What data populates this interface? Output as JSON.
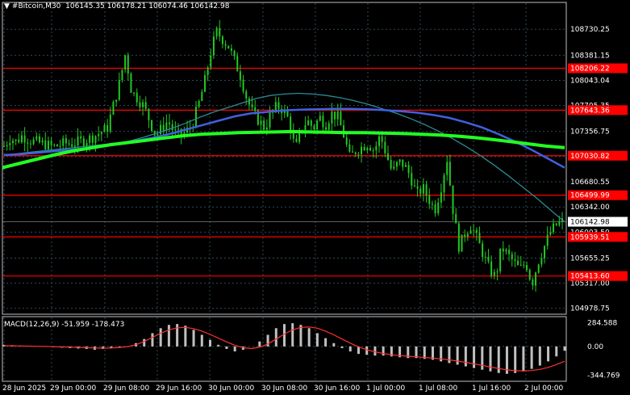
{
  "header": {
    "symbol": "#Bitcoin,M30",
    "open": "106145.35",
    "high": "106178.21",
    "low": "106074.46",
    "close": "106142.98"
  },
  "macd_header": {
    "label": "MACD(12,26,9)",
    "macd": "-51.959",
    "signal": "-178.473"
  },
  "colors": {
    "background": "#000000",
    "grid": "#2e4a5a",
    "candle": "#22c822",
    "ma_fast": "#2a8a94",
    "ma_mid": "#4060e0",
    "ma_slow": "#22ff22",
    "level": "#ff0000",
    "macd_hist": "#c0c0c0",
    "macd_signal": "#ff3030",
    "current_price_line": "#808080"
  },
  "chart_data": {
    "type": "candlestick",
    "y_axis_ticks": [
      108730.25,
      108381.15,
      108043.04,
      107705.35,
      107356.75,
      107018.65,
      106680.55,
      106342.0,
      106003.5,
      105655.25,
      105317.0,
      104978.75
    ],
    "ylim": [
      104900,
      108950
    ],
    "x_axis_ticks": [
      "28 Jun 2025",
      "29 Jun 00:00",
      "29 Jun 08:00",
      "29 Jun 16:00",
      "30 Jun 00:00",
      "30 Jun 08:00",
      "30 Jun 16:00",
      "1 Jul 00:00",
      "1 Jul 08:00",
      "1 Jul 16:00",
      "2 Jul 00:00"
    ],
    "current_price": "106142.98",
    "levels": [
      {
        "price": "108206.22",
        "value": 108206.22
      },
      {
        "price": "107643.36",
        "value": 107643.36
      },
      {
        "price": "107030.82",
        "value": 107030.82
      },
      {
        "price": "106499.99",
        "value": 106499.99
      },
      {
        "price": "105939.51",
        "value": 105939.51
      },
      {
        "price": "105413.60",
        "value": 105413.6
      }
    ],
    "close_path": [
      107160,
      107270,
      107220,
      107300,
      107250,
      107220,
      107200,
      107180,
      107150,
      107170,
      107200,
      107190,
      107210,
      107230,
      107260,
      107300,
      107350,
      107400,
      107700,
      108000,
      108400,
      107900,
      107800,
      107700,
      107500,
      107300,
      107400,
      107500,
      107350,
      107300,
      107350,
      107450,
      107700,
      108000,
      108400,
      108700,
      108600,
      108500,
      108300,
      108100,
      107800,
      107600,
      107500,
      107400,
      107600,
      107700,
      107650,
      107500,
      107100,
      107400,
      107500,
      107400,
      107550,
      107450,
      107600,
      107550,
      107300,
      107000,
      107100,
      107150,
      107200,
      107100,
      107300,
      107050,
      106800,
      106950,
      106900,
      106750,
      106500,
      106600,
      106450,
      106300,
      106600,
      107000,
      106300,
      105800,
      106000,
      106100,
      105900,
      105700,
      105500,
      105400,
      105800,
      105700,
      105600,
      105500,
      105600,
      105300,
      105600,
      105800,
      106000,
      106100,
      106143
    ],
    "ma_fast": [
      107040,
      107060,
      107080,
      107100,
      107120,
      107140,
      107160,
      107180,
      107200,
      107230,
      107280,
      107340,
      107400,
      107470,
      107550,
      107620,
      107680,
      107740,
      107800,
      107840,
      107860,
      107870,
      107860,
      107840,
      107810,
      107770,
      107720,
      107660,
      107600,
      107530,
      107450,
      107360,
      107260,
      107150,
      107030,
      106900,
      106760,
      106610,
      106460,
      106300,
      106140
    ],
    "ma_mid": [
      107040,
      107050,
      107070,
      107090,
      107110,
      107130,
      107160,
      107190,
      107230,
      107270,
      107320,
      107380,
      107440,
      107500,
      107560,
      107600,
      107620,
      107640,
      107650,
      107655,
      107660,
      107660,
      107655,
      107645,
      107630,
      107610,
      107580,
      107540,
      107480,
      107410,
      107320,
      107220,
      107110,
      106990,
      106870
    ],
    "ma_slow": [
      106870,
      106930,
      106990,
      107050,
      107100,
      107140,
      107180,
      107210,
      107240,
      107270,
      107300,
      107320,
      107330,
      107340,
      107345,
      107350,
      107355,
      107350,
      107345,
      107340,
      107340,
      107335,
      107330,
      107320,
      107310,
      107295,
      107275,
      107250,
      107220,
      107190,
      107160,
      107140
    ],
    "macd": {
      "ticks": [
        "284.588",
        "0.00",
        "-344.769"
      ],
      "range": [
        -400,
        330
      ],
      "histogram": [
        20,
        15,
        10,
        5,
        0,
        -5,
        -10,
        -15,
        -20,
        -25,
        -30,
        -40,
        -30,
        -20,
        -10,
        0,
        40,
        90,
        160,
        220,
        260,
        270,
        250,
        200,
        140,
        80,
        20,
        -30,
        -60,
        -40,
        0,
        60,
        140,
        220,
        270,
        280,
        260,
        220,
        160,
        100,
        40,
        -20,
        -60,
        -90,
        -100,
        -110,
        -110,
        -120,
        -130,
        -140,
        -140,
        -150,
        -160,
        -180,
        -200,
        -220,
        -240,
        -260,
        -280,
        -300,
        -320,
        -330,
        -320,
        -300,
        -270,
        -230,
        -180,
        -120,
        -52
      ],
      "signal": [
        10,
        8,
        6,
        4,
        2,
        0,
        -3,
        -6,
        -9,
        -12,
        -15,
        -18,
        -20,
        -18,
        -12,
        -2,
        20,
        60,
        110,
        160,
        200,
        225,
        230,
        215,
        185,
        145,
        100,
        55,
        15,
        -15,
        -25,
        -10,
        30,
        90,
        150,
        200,
        230,
        235,
        220,
        185,
        140,
        90,
        40,
        -5,
        -40,
        -65,
        -85,
        -100,
        -110,
        -118,
        -125,
        -132,
        -140,
        -150,
        -162,
        -176,
        -192,
        -210,
        -228,
        -248,
        -266,
        -282,
        -292,
        -295,
        -290,
        -276,
        -252,
        -218,
        -178
      ]
    }
  }
}
